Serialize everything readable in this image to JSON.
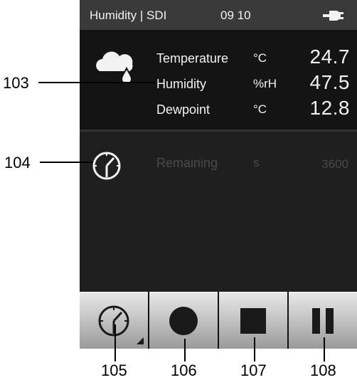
{
  "status": {
    "title": "Humidity | SDI",
    "time": "09 10"
  },
  "measurements": [
    {
      "label": "Temperature",
      "unit": "°C",
      "value": "24.7"
    },
    {
      "label": "Humidity",
      "unit": "%rH",
      "value": "47.5"
    },
    {
      "label": "Dewpoint",
      "unit": "°C",
      "value": "12.8"
    }
  ],
  "timer": {
    "label": "Remaining",
    "unit": "s",
    "value": "3600"
  },
  "toolbar": {
    "buttons": [
      "timer-settings",
      "record",
      "stop",
      "pause"
    ]
  },
  "callouts": {
    "measurements": "103",
    "timer": "104",
    "timer_button": "105",
    "record_button": "106",
    "stop_button": "107",
    "pause_button": "108"
  },
  "icons": [
    "plug-icon",
    "cloud-rain-icon",
    "clock-icon",
    "record-icon",
    "stop-icon",
    "pause-icon"
  ],
  "colors": {
    "screen_bg": "#1e1e1e",
    "status_bg": "#3a3a3a",
    "text": "#f2f2f2",
    "dim_text": "#4a4a4a",
    "button_face": "#d0d0d0"
  }
}
